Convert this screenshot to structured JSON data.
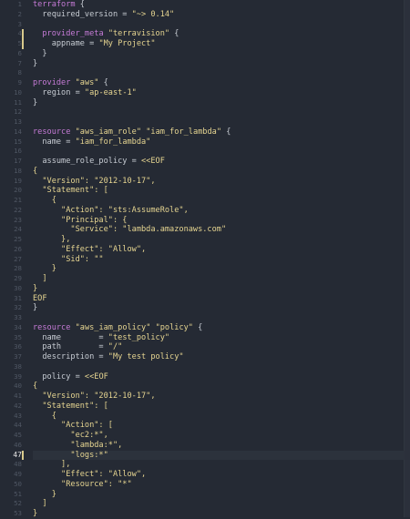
{
  "editor": {
    "current_line": 47,
    "colors": {
      "background": "#252a34",
      "keyword": "#c67bd7",
      "string": "#e6d591",
      "modified_marker": "#d8c98c"
    },
    "lines": [
      {
        "n": "1",
        "tokens": [
          [
            "k",
            "terraform"
          ],
          [
            "t",
            " {"
          ]
        ]
      },
      {
        "n": "2",
        "tokens": [
          [
            "t",
            "  required_version = "
          ],
          [
            "s",
            "\"~> 0.14\""
          ]
        ]
      },
      {
        "n": "3",
        "tokens": []
      },
      {
        "n": "4",
        "mark": true,
        "tokens": [
          [
            "t",
            "  "
          ],
          [
            "k",
            "provider_meta"
          ],
          [
            "t",
            " "
          ],
          [
            "s",
            "\"terravision\""
          ],
          [
            "t",
            " {"
          ]
        ]
      },
      {
        "n": "5",
        "mark": true,
        "tokens": [
          [
            "t",
            "    appname = "
          ],
          [
            "s",
            "\"My Project\""
          ]
        ]
      },
      {
        "n": "6",
        "tokens": [
          [
            "t",
            "  }"
          ]
        ]
      },
      {
        "n": "7",
        "tokens": [
          [
            "t",
            "}"
          ]
        ]
      },
      {
        "n": "8",
        "tokens": []
      },
      {
        "n": "9",
        "tokens": [
          [
            "k",
            "provider"
          ],
          [
            "t",
            " "
          ],
          [
            "s",
            "\"aws\""
          ],
          [
            "t",
            " {"
          ]
        ]
      },
      {
        "n": "10",
        "tokens": [
          [
            "t",
            "  region = "
          ],
          [
            "s",
            "\"ap-east-1\""
          ]
        ]
      },
      {
        "n": "11",
        "tokens": [
          [
            "t",
            "}"
          ]
        ]
      },
      {
        "n": "12",
        "tokens": []
      },
      {
        "n": "13",
        "tokens": []
      },
      {
        "n": "14",
        "tokens": [
          [
            "k",
            "resource"
          ],
          [
            "t",
            " "
          ],
          [
            "s",
            "\"aws_iam_role\""
          ],
          [
            "t",
            " "
          ],
          [
            "s",
            "\"iam_for_lambda\""
          ],
          [
            "t",
            " {"
          ]
        ]
      },
      {
        "n": "15",
        "tokens": [
          [
            "t",
            "  name = "
          ],
          [
            "s",
            "\"iam_for_lambda\""
          ]
        ]
      },
      {
        "n": "16",
        "tokens": []
      },
      {
        "n": "17",
        "tokens": [
          [
            "t",
            "  assume_role_policy = "
          ],
          [
            "h",
            "<<EOF"
          ]
        ]
      },
      {
        "n": "18",
        "tokens": [
          [
            "h",
            "{"
          ]
        ]
      },
      {
        "n": "19",
        "tokens": [
          [
            "h",
            "  \"Version\": \"2012-10-17\","
          ]
        ]
      },
      {
        "n": "20",
        "tokens": [
          [
            "h",
            "  \"Statement\": ["
          ]
        ]
      },
      {
        "n": "21",
        "tokens": [
          [
            "h",
            "    {"
          ]
        ]
      },
      {
        "n": "22",
        "tokens": [
          [
            "h",
            "      \"Action\": \"sts:AssumeRole\","
          ]
        ]
      },
      {
        "n": "23",
        "tokens": [
          [
            "h",
            "      \"Principal\": {"
          ]
        ]
      },
      {
        "n": "24",
        "tokens": [
          [
            "h",
            "        \"Service\": \"lambda.amazonaws.com\""
          ]
        ]
      },
      {
        "n": "25",
        "tokens": [
          [
            "h",
            "      },"
          ]
        ]
      },
      {
        "n": "26",
        "tokens": [
          [
            "h",
            "      \"Effect\": \"Allow\","
          ]
        ]
      },
      {
        "n": "27",
        "tokens": [
          [
            "h",
            "      \"Sid\": \"\""
          ]
        ]
      },
      {
        "n": "28",
        "tokens": [
          [
            "h",
            "    }"
          ]
        ]
      },
      {
        "n": "29",
        "tokens": [
          [
            "h",
            "  ]"
          ]
        ]
      },
      {
        "n": "30",
        "tokens": [
          [
            "h",
            "}"
          ]
        ]
      },
      {
        "n": "31",
        "tokens": [
          [
            "h",
            "EOF"
          ]
        ]
      },
      {
        "n": "32",
        "tokens": [
          [
            "t",
            "}"
          ]
        ]
      },
      {
        "n": "33",
        "tokens": []
      },
      {
        "n": "34",
        "tokens": [
          [
            "k",
            "resource"
          ],
          [
            "t",
            " "
          ],
          [
            "s",
            "\"aws_iam_policy\""
          ],
          [
            "t",
            " "
          ],
          [
            "s",
            "\"policy\""
          ],
          [
            "t",
            " {"
          ]
        ]
      },
      {
        "n": "35",
        "tokens": [
          [
            "t",
            "  name        = "
          ],
          [
            "s",
            "\"test_policy\""
          ]
        ]
      },
      {
        "n": "36",
        "tokens": [
          [
            "t",
            "  path        = "
          ],
          [
            "s",
            "\"/\""
          ]
        ]
      },
      {
        "n": "37",
        "tokens": [
          [
            "t",
            "  description = "
          ],
          [
            "s",
            "\"My test policy\""
          ]
        ]
      },
      {
        "n": "38",
        "tokens": []
      },
      {
        "n": "39",
        "tokens": [
          [
            "t",
            "  policy = "
          ],
          [
            "h",
            "<<EOF"
          ]
        ]
      },
      {
        "n": "40",
        "tokens": [
          [
            "h",
            "{"
          ]
        ]
      },
      {
        "n": "41",
        "tokens": [
          [
            "h",
            "  \"Version\": \"2012-10-17\","
          ]
        ]
      },
      {
        "n": "42",
        "tokens": [
          [
            "h",
            "  \"Statement\": ["
          ]
        ]
      },
      {
        "n": "43",
        "tokens": [
          [
            "h",
            "    {"
          ]
        ]
      },
      {
        "n": "44",
        "tokens": [
          [
            "h",
            "      \"Action\": ["
          ]
        ]
      },
      {
        "n": "45",
        "tokens": [
          [
            "h",
            "        \"ec2:*\","
          ]
        ]
      },
      {
        "n": "46",
        "tokens": [
          [
            "h",
            "        \"lambda:*\","
          ]
        ]
      },
      {
        "n": "47",
        "mark": true,
        "current": true,
        "tokens": [
          [
            "h",
            "        \"logs:*\""
          ]
        ]
      },
      {
        "n": "48",
        "tokens": [
          [
            "h",
            "      ],"
          ]
        ]
      },
      {
        "n": "49",
        "tokens": [
          [
            "h",
            "      \"Effect\": \"Allow\","
          ]
        ]
      },
      {
        "n": "50",
        "tokens": [
          [
            "h",
            "      \"Resource\": \"*\""
          ]
        ]
      },
      {
        "n": "51",
        "tokens": [
          [
            "h",
            "    }"
          ]
        ]
      },
      {
        "n": "52",
        "tokens": [
          [
            "h",
            "  ]"
          ]
        ]
      },
      {
        "n": "53",
        "tokens": [
          [
            "h",
            "}"
          ]
        ]
      }
    ]
  }
}
